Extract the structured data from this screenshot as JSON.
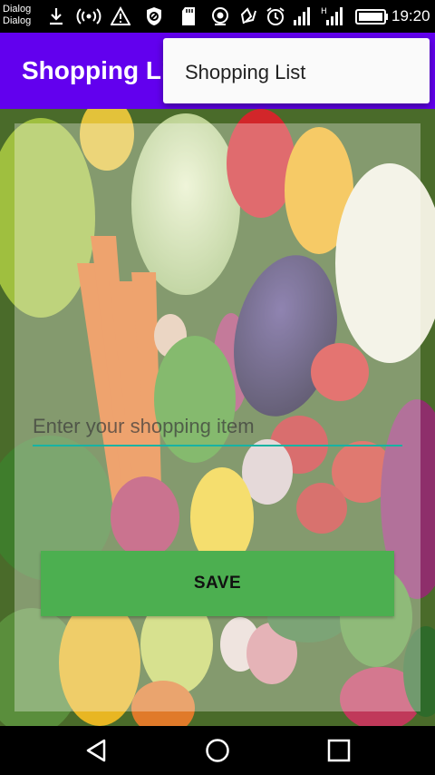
{
  "status_bar": {
    "notifications": [
      "Dialog",
      "Dialog"
    ],
    "icons": [
      "download-icon",
      "hotspot-icon",
      "warning-icon",
      "data-saver-icon",
      "sd-card-icon",
      "camera-icon",
      "nfc-icon",
      "alarm-icon",
      "signal-icon",
      "signal-h-icon",
      "battery-icon"
    ],
    "time": "19:20"
  },
  "app_bar": {
    "title": "Shopping List",
    "background": "#6200ee"
  },
  "overflow_menu": {
    "items": [
      {
        "label": "Shopping List"
      }
    ]
  },
  "form": {
    "item_input": {
      "placeholder": "Enter your shopping item",
      "value": ""
    },
    "save_button": {
      "label": "SAVE",
      "color": "#4caf50"
    },
    "accent": "#17b3a3"
  },
  "nav_bar": {
    "icons": [
      "back-icon",
      "home-icon",
      "recents-icon"
    ]
  }
}
